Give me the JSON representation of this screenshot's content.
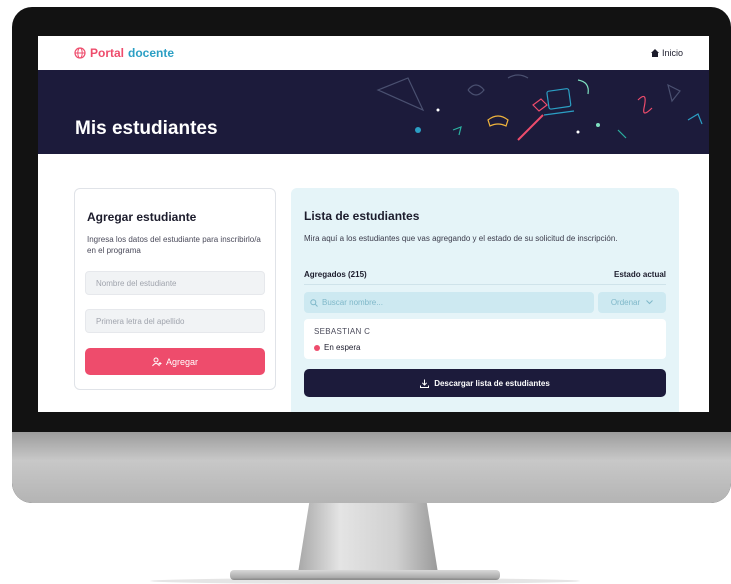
{
  "brand": {
    "word1": "Portal",
    "word2": "docente",
    "accent": "#ee4c6c",
    "secondary": "#2b9fc4"
  },
  "nav": {
    "home_label": "Inicio"
  },
  "hero": {
    "title": "Mis estudiantes",
    "background": "#1c1b3b"
  },
  "add_student": {
    "title": "Agregar estudiante",
    "description": "Ingresa los datos del estudiante para inscribirlo/a en el programa",
    "name_placeholder": "Nombre del estudiante",
    "surname_placeholder": "Primera letra del apellido",
    "add_button": "Agregar"
  },
  "student_list": {
    "title": "Lista de estudiantes",
    "description": "Mira aquí a los estudiantes que vas agregando y el estado de su solicitud de inscripción.",
    "count_label": "Agregados (215)",
    "status_label": "Estado actual",
    "search_placeholder": "Buscar nombre...",
    "sort_label": "Ordenar",
    "items": [
      {
        "name": "SEBASTIAN C",
        "status": "En espera",
        "status_color": "#ee4c6c"
      }
    ],
    "download_button": "Descargar lista de estudiantes"
  }
}
